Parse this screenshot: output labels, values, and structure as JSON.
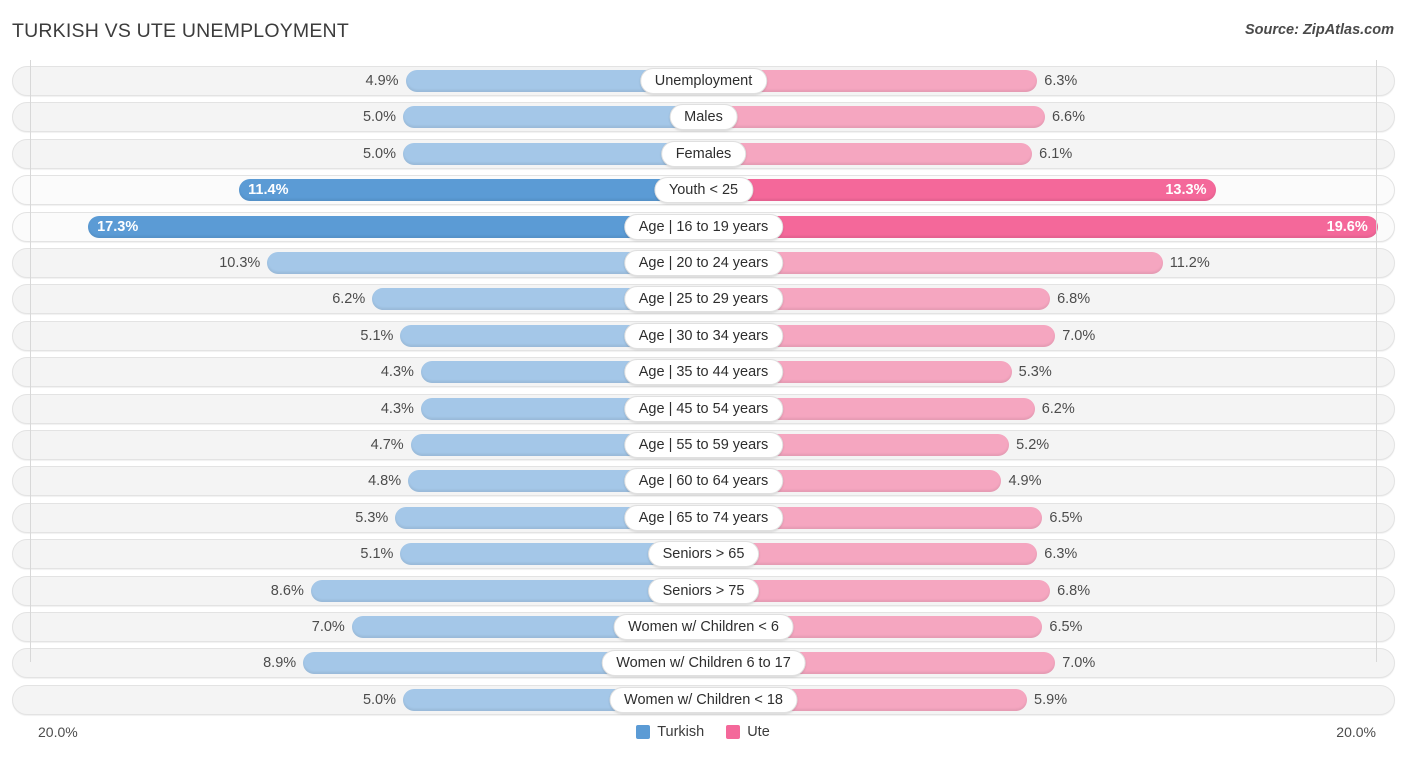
{
  "header": {
    "title": "TURKISH VS UTE UNEMPLOYMENT",
    "source": "Source: ZipAtlas.com"
  },
  "footer": {
    "axis_left": "20.0%",
    "axis_right": "20.0%",
    "legend": [
      {
        "label": "Turkish",
        "color": "#5b9bd5"
      },
      {
        "label": "Ute",
        "color": "#f4689a"
      }
    ]
  },
  "colors": {
    "left_bar": "#a4c7e8",
    "left_bar_highlight": "#5b9bd5",
    "right_bar": "#f5a6c0",
    "right_bar_highlight": "#f4689a",
    "row_band": "#f4f4f4",
    "gridline": "#d8d8d8"
  },
  "chart_data": {
    "type": "bar",
    "title": "TURKISH VS UTE UNEMPLOYMENT",
    "subtitle": "Source: ZipAtlas.com",
    "orientation": "horizontal-diverging",
    "xlabel": "",
    "ylabel": "",
    "xlim": [
      20.0,
      20.0
    ],
    "axis_tick_labels": [
      "20.0%",
      "20.0%"
    ],
    "grid": true,
    "legend_position": "bottom-center",
    "categories": [
      "Unemployment",
      "Males",
      "Females",
      "Youth < 25",
      "Age | 16 to 19 years",
      "Age | 20 to 24 years",
      "Age | 25 to 29 years",
      "Age | 30 to 34 years",
      "Age | 35 to 44 years",
      "Age | 45 to 54 years",
      "Age | 55 to 59 years",
      "Age | 60 to 64 years",
      "Age | 65 to 74 years",
      "Seniors > 65",
      "Seniors > 75",
      "Women w/ Children < 6",
      "Women w/ Children 6 to 17",
      "Women w/ Children < 18"
    ],
    "series": [
      {
        "name": "Turkish",
        "side": "left",
        "color": "#a4c7e8",
        "values": [
          4.9,
          5.0,
          5.0,
          11.4,
          17.3,
          10.3,
          6.2,
          5.1,
          4.3,
          4.3,
          4.7,
          4.8,
          5.3,
          5.1,
          8.6,
          7.0,
          8.9,
          5.0
        ],
        "labels": [
          "4.9%",
          "5.0%",
          "5.0%",
          "11.4%",
          "17.3%",
          "10.3%",
          "6.2%",
          "5.1%",
          "4.3%",
          "4.3%",
          "4.7%",
          "4.8%",
          "5.3%",
          "5.1%",
          "8.6%",
          "7.0%",
          "8.9%",
          "5.0%"
        ]
      },
      {
        "name": "Ute",
        "side": "right",
        "color": "#f5a6c0",
        "values": [
          6.3,
          6.6,
          6.1,
          13.3,
          19.6,
          11.2,
          6.8,
          7.0,
          5.3,
          6.2,
          5.2,
          4.9,
          6.5,
          6.3,
          6.8,
          6.5,
          7.0,
          5.9
        ],
        "labels": [
          "6.3%",
          "6.6%",
          "6.1%",
          "13.3%",
          "19.6%",
          "11.2%",
          "6.8%",
          "7.0%",
          "5.3%",
          "6.2%",
          "5.2%",
          "4.9%",
          "6.5%",
          "6.3%",
          "6.8%",
          "6.5%",
          "7.0%",
          "5.9%"
        ]
      }
    ],
    "highlighted_rows": [
      "Youth < 25",
      "Age | 16 to 19 years"
    ]
  },
  "rows": [
    {
      "label": "Unemployment",
      "left": "4.9%",
      "right": "6.3%",
      "left_val": 4.9,
      "right_val": 6.3,
      "highlight": false
    },
    {
      "label": "Males",
      "left": "5.0%",
      "right": "6.6%",
      "left_val": 5.0,
      "right_val": 6.6,
      "highlight": false
    },
    {
      "label": "Females",
      "left": "5.0%",
      "right": "6.1%",
      "left_val": 5.0,
      "right_val": 6.1,
      "highlight": false
    },
    {
      "label": "Youth < 25",
      "left": "11.4%",
      "right": "13.3%",
      "left_val": 11.4,
      "right_val": 13.3,
      "highlight": true
    },
    {
      "label": "Age | 16 to 19 years",
      "left": "17.3%",
      "right": "19.6%",
      "left_val": 17.3,
      "right_val": 19.6,
      "highlight": true
    },
    {
      "label": "Age | 20 to 24 years",
      "left": "10.3%",
      "right": "11.2%",
      "left_val": 10.3,
      "right_val": 11.2,
      "highlight": false
    },
    {
      "label": "Age | 25 to 29 years",
      "left": "6.2%",
      "right": "6.8%",
      "left_val": 6.2,
      "right_val": 6.8,
      "highlight": false
    },
    {
      "label": "Age | 30 to 34 years",
      "left": "5.1%",
      "right": "7.0%",
      "left_val": 5.1,
      "right_val": 7.0,
      "highlight": false
    },
    {
      "label": "Age | 35 to 44 years",
      "left": "4.3%",
      "right": "5.3%",
      "left_val": 4.3,
      "right_val": 5.3,
      "highlight": false
    },
    {
      "label": "Age | 45 to 54 years",
      "left": "4.3%",
      "right": "6.2%",
      "left_val": 4.3,
      "right_val": 6.2,
      "highlight": false
    },
    {
      "label": "Age | 55 to 59 years",
      "left": "4.7%",
      "right": "5.2%",
      "left_val": 4.7,
      "right_val": 5.2,
      "highlight": false
    },
    {
      "label": "Age | 60 to 64 years",
      "left": "4.8%",
      "right": "4.9%",
      "left_val": 4.8,
      "right_val": 4.9,
      "highlight": false
    },
    {
      "label": "Age | 65 to 74 years",
      "left": "5.3%",
      "right": "6.5%",
      "left_val": 5.3,
      "right_val": 6.5,
      "highlight": false
    },
    {
      "label": "Seniors > 65",
      "left": "5.1%",
      "right": "6.3%",
      "left_val": 5.1,
      "right_val": 6.3,
      "highlight": false
    },
    {
      "label": "Seniors > 75",
      "left": "8.6%",
      "right": "6.8%",
      "left_val": 8.6,
      "right_val": 6.8,
      "highlight": false
    },
    {
      "label": "Women w/ Children < 6",
      "left": "7.0%",
      "right": "6.5%",
      "left_val": 7.0,
      "right_val": 6.5,
      "highlight": false
    },
    {
      "label": "Women w/ Children 6 to 17",
      "left": "8.9%",
      "right": "7.0%",
      "left_val": 8.9,
      "right_val": 7.0,
      "highlight": false
    },
    {
      "label": "Women w/ Children < 18",
      "left": "5.0%",
      "right": "5.9%",
      "left_val": 5.0,
      "right_val": 5.9,
      "highlight": false
    }
  ]
}
